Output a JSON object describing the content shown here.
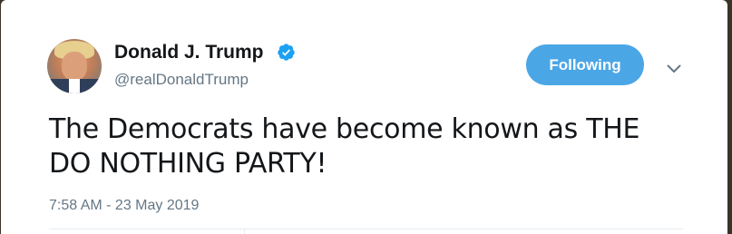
{
  "tweet": {
    "author": {
      "display_name": "Donald J. Trump",
      "screen_name": "@realDonaldTrump",
      "verified": true,
      "avatar_icon": "profile-photo"
    },
    "follow_button_label": "Following",
    "text": "The Democrats have become known as THE DO NOTHING PARTY!",
    "timestamp": "7:58 AM - 23 May 2019"
  },
  "colors": {
    "accent": "#4ba6e6",
    "verified_badge": "#1da1f2",
    "primary_text": "#14171a",
    "secondary_text": "#657786",
    "divider": "#e6ecf0"
  },
  "icons": {
    "verified": "verified-badge-icon",
    "more_options": "chevron-down-icon"
  }
}
